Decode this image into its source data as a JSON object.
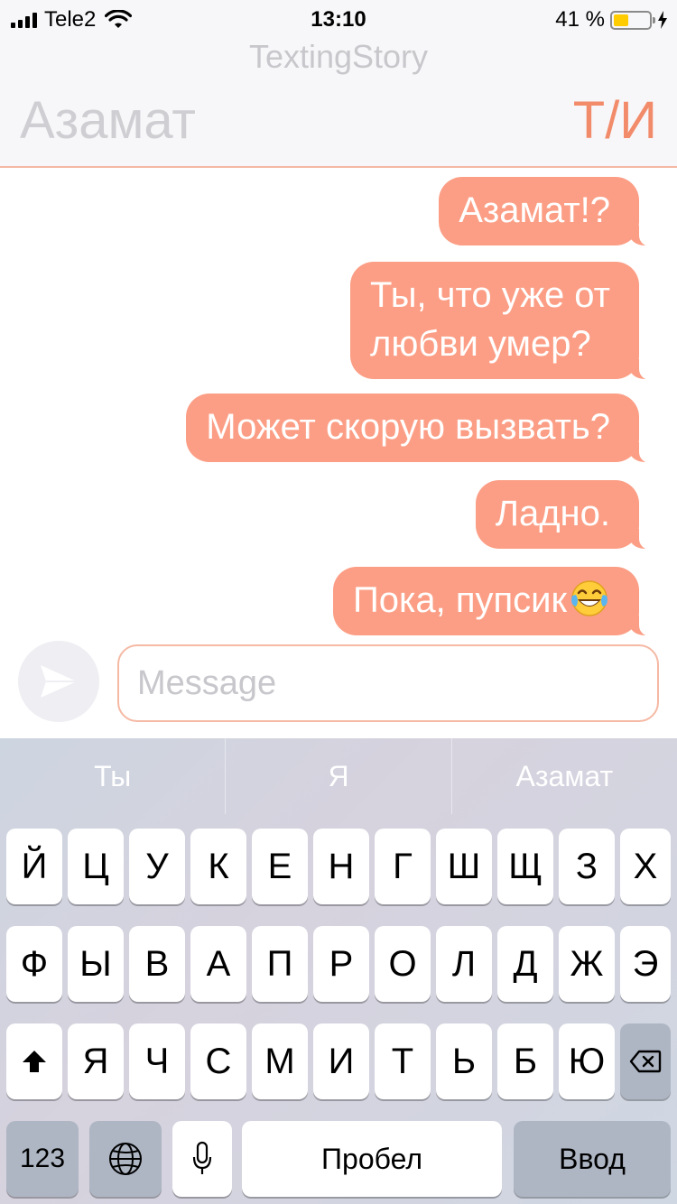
{
  "status_bar": {
    "carrier": "Tele2",
    "time": "13:10",
    "battery_text": "41 %",
    "battery_level": 0.41
  },
  "header": {
    "watermark": "TextingStory",
    "contact_name": "Азамат",
    "profile_label": "Т/И"
  },
  "messages": [
    {
      "line1": "Азамат!?"
    },
    {
      "line1": "Ты, что уже от",
      "line2": "любви умер?"
    },
    {
      "line1": "Может скорую вызвать?"
    },
    {
      "line1": "Ладно."
    },
    {
      "line1": "Пока, пупсик",
      "emoji": "tears-of-joy-emoji"
    }
  ],
  "input": {
    "placeholder": "Message"
  },
  "keyboard": {
    "suggestions": [
      "Ты",
      "Я",
      "Азамат"
    ],
    "row1": [
      "Й",
      "Ц",
      "У",
      "К",
      "Е",
      "Н",
      "Г",
      "Ш",
      "Щ",
      "З",
      "Х"
    ],
    "row2": [
      "Ф",
      "Ы",
      "В",
      "А",
      "П",
      "Р",
      "О",
      "Л",
      "Д",
      "Ж",
      "Э"
    ],
    "row3": [
      "Я",
      "Ч",
      "С",
      "М",
      "И",
      "Т",
      "Ь",
      "Б",
      "Ю"
    ],
    "numbers_label": "123",
    "space_label": "Пробел",
    "return_label": "Ввод"
  },
  "colors": {
    "bubble": "#fc9e85",
    "accent": "#f28b6a",
    "battery": "#ffcc00"
  }
}
